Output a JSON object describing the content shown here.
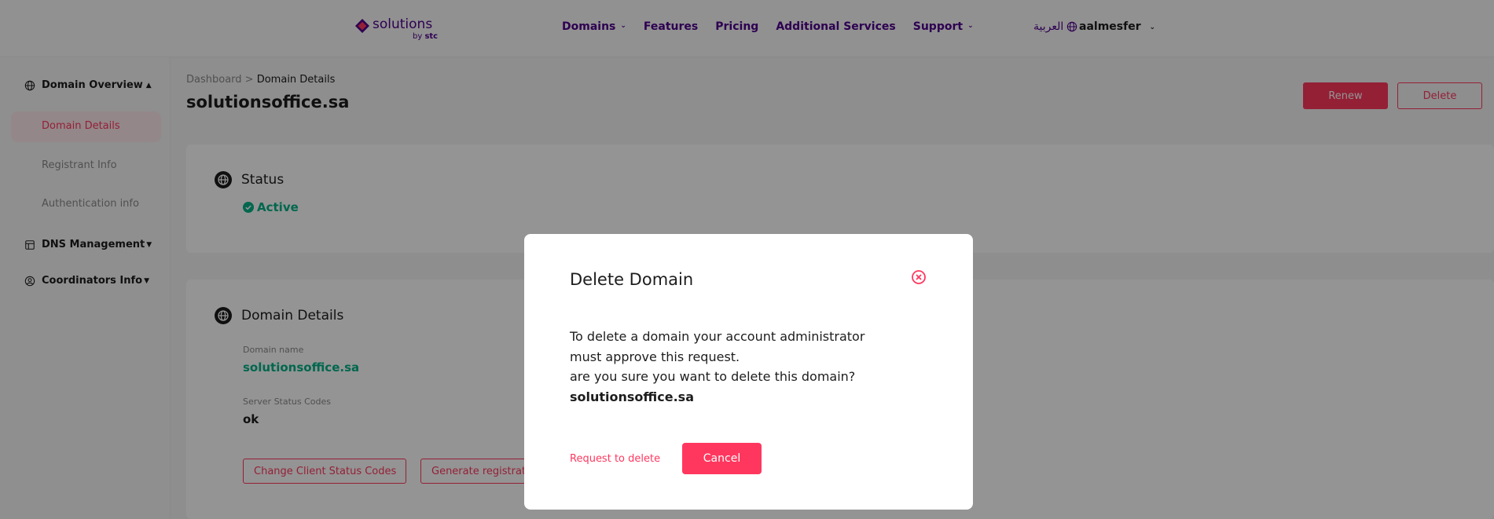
{
  "header": {
    "logo_text": "solutions",
    "logo_by": "by",
    "logo_brand": "stc",
    "nav": [
      {
        "label": "Domains",
        "has_dropdown": true
      },
      {
        "label": "Features",
        "has_dropdown": false
      },
      {
        "label": "Pricing",
        "has_dropdown": false
      },
      {
        "label": "Additional Services",
        "has_dropdown": false
      },
      {
        "label": "Support",
        "has_dropdown": true
      }
    ],
    "language": "العربية",
    "user": "aalmesfer"
  },
  "sidebar": {
    "domain_overview": "Domain Overview",
    "items": [
      "Domain Details",
      "Registrant Info",
      "Authentication info"
    ],
    "dns": "DNS Management",
    "coordinators": "Coordinators Info"
  },
  "breadcrumb": {
    "root": "Dashboard",
    "separator": ">",
    "current": "Domain Details"
  },
  "page": {
    "title": "solutionsoffice.sa",
    "renew_label": "Renew",
    "delete_label": "Delete"
  },
  "status_card": {
    "heading": "Status",
    "value": "Active"
  },
  "details_card": {
    "heading": "Domain Details",
    "domain_label": "Domain name",
    "domain_value": "solutionsoffice.sa",
    "server_label": "Server Status Codes",
    "server_value": "ok",
    "btn_change": "Change Client Status Codes",
    "btn_generate": "Generate registration certificate"
  },
  "modal": {
    "title": "Delete Domain",
    "line1": "To delete a domain your account administrator must approve this request.",
    "line2": "are you sure you want to delete this domain?",
    "domain": "solutionsoffice.sa",
    "request_label": "Request to delete",
    "cancel_label": "Cancel"
  },
  "colors": {
    "brand": "#4f008c",
    "accent": "#ff375e",
    "success": "#00b287"
  },
  "icons": [
    "globe-icon",
    "chevron-down-icon",
    "caret-up-icon",
    "caret-down-icon",
    "dns-icon",
    "user-circle-icon",
    "check-circle-icon",
    "close-circle-icon"
  ]
}
